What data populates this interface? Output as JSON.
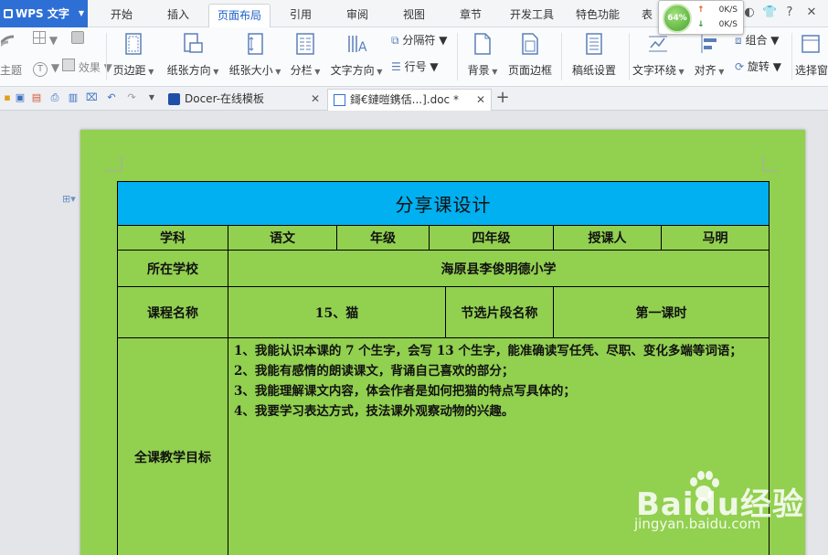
{
  "app": {
    "name": "WPS 文字"
  },
  "menu": {
    "tabs": [
      "开始",
      "插入",
      "页面布局",
      "引用",
      "审阅",
      "视图",
      "章节",
      "开发工具",
      "特色功能",
      "表"
    ],
    "active_tab": "页面布局"
  },
  "net_widget": {
    "percent": "64%",
    "upload": "0K/S",
    "download": "0K/S"
  },
  "ribbon": {
    "theme": "主题",
    "effect": "效果",
    "margins": "页边距",
    "orientation": "纸张方向",
    "size": "纸张大小",
    "columns": "分栏",
    "text_direction": "文字方向",
    "breaks": "分隔符",
    "line_numbers": "行号",
    "background": "背景",
    "page_border": "页面边框",
    "manuscript": "稿纸设置",
    "text_wrap": "文字环绕",
    "align": "对齐",
    "group": "组合",
    "rotate": "旋转",
    "selection_pane": "选择窗"
  },
  "doc_tabs": [
    {
      "label": "Docer-在线模板"
    },
    {
      "label": "鎶€鏈暟鎸佸...].doc *"
    }
  ],
  "document": {
    "title": "分享课设计",
    "row1": {
      "subject_label": "学科",
      "subject": "语文",
      "grade_label": "年级",
      "grade": "四年级",
      "teacher_label": "授课人",
      "teacher": "马明"
    },
    "school_label": "所在学校",
    "school": "海原县李俊明德小学",
    "course_label": "课程名称",
    "course": "15、猫",
    "excerpt_label": "节选片段名称",
    "excerpt": "第一课时",
    "goals_label": "全课教学目标",
    "goals": [
      "1、我能认识本课的 7 个生字，会写 13 个生字，能准确读写任凭、尽职、变化多端等词语；",
      "2、我能有感情的朗读课文，背诵自己喜欢的部分；",
      "3、我能理解课文内容，体会作者是如何把猫的特点写具体的；",
      "4、我要学习表达方式，技法课外观察动物的兴趣。"
    ]
  },
  "watermark": {
    "brand": "Baidu经验",
    "url": "jingyan.baidu.com"
  },
  "colors": {
    "page_background": "#92d050",
    "title_background": "#00b0f0",
    "accent": "#2e6fd6"
  }
}
